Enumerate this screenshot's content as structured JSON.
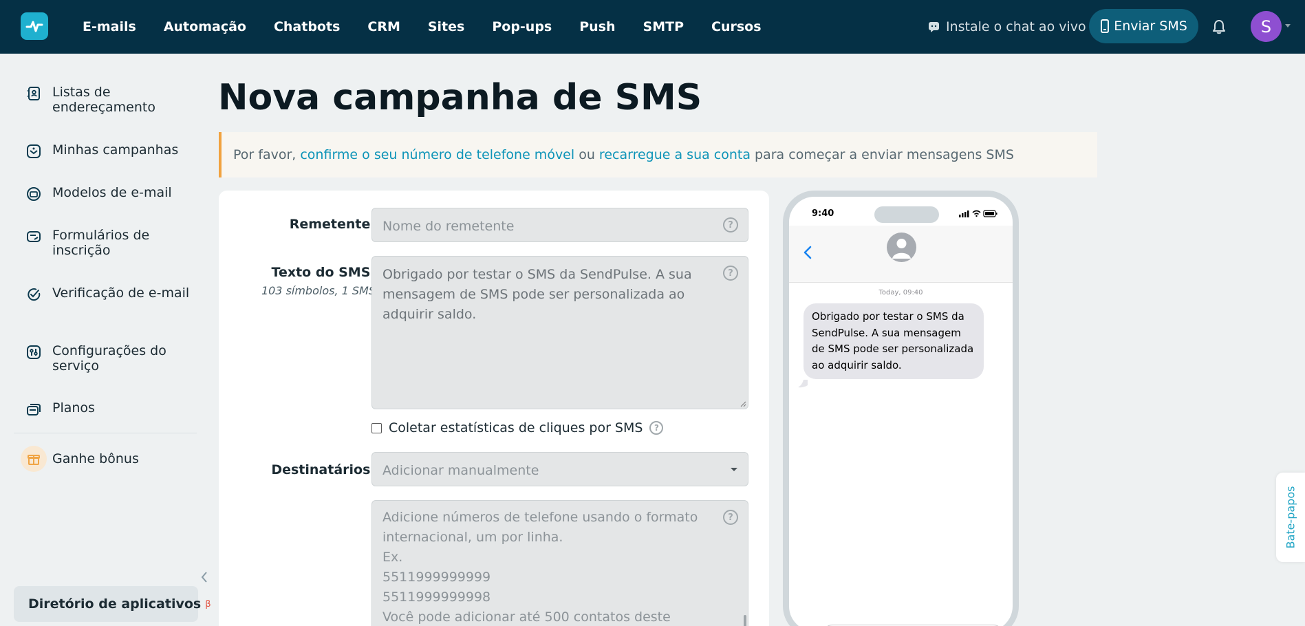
{
  "nav": {
    "items": [
      "E-mails",
      "Automação",
      "Chatbots",
      "CRM",
      "Sites",
      "Pop-ups",
      "Push",
      "SMTP",
      "Cursos"
    ],
    "chat_live": "Instale o chat ao vivo",
    "send_sms": "Enviar SMS",
    "avatar_initial": "S"
  },
  "sidebar": {
    "items": [
      {
        "label": "Listas de endereçamento",
        "icon": "contact-book-icon"
      },
      {
        "label": "Minhas campanhas",
        "icon": "campaigns-icon"
      },
      {
        "label": "Modelos de e-mail",
        "icon": "email-template-icon"
      },
      {
        "label": "Formulários de inscrição",
        "icon": "subscription-form-icon"
      },
      {
        "label": "Verificação de e-mail",
        "icon": "email-verification-icon"
      },
      {
        "label": "Configurações do serviço",
        "icon": "service-settings-icon"
      },
      {
        "label": "Planos",
        "icon": "plans-icon"
      }
    ],
    "bonus": "Ganhe bônus",
    "apps_directory": "Diretório de aplicativos",
    "apps_badge": "β"
  },
  "page": {
    "title": "Nova campanha de SMS"
  },
  "notice": {
    "prefix": "Por favor,",
    "link_confirm": "confirme o seu número de telefone móvel",
    "middle": "ou",
    "link_recharge": "recarregue a sua conta",
    "suffix": "para começar a enviar mensagens SMS"
  },
  "form": {
    "sender_label": "Remetente:",
    "sender_placeholder": "Nome do remetente",
    "sms_text_label": "Texto do SMS:",
    "sms_counter": "103 símbolos, 1 SMS",
    "sms_text_value": "Obrigado por testar o SMS da SendPulse. A sua mensagem de SMS pode ser personalizada ao adquirir saldo.",
    "click_stats_label": "Coletar estatísticas de cliques por SMS",
    "recipients_label": "Destinatários:",
    "recipients_select": "Adicionar manualmente",
    "recipients_placeholder_lines": [
      "Adicione números de telefone usando o formato",
      "internacional, um por linha.",
      "Ex.",
      "5511999999999",
      "5511999999998",
      "Você pode adicionar até 500 contatos deste"
    ]
  },
  "phone": {
    "time": "9:40",
    "timestamp": "Today, 09:40",
    "message": "Obrigado por testar o SMS da SendPulse. A sua mensagem de SMS pode ser personalizada ao adquirir saldo."
  },
  "chat_tab": "Bate-papos",
  "colors": {
    "topbar": "#053045",
    "accent": "#1fb0cf",
    "link": "#0e94b8",
    "notice_border": "#f1a23f",
    "avatar": "#8e4fd1"
  }
}
